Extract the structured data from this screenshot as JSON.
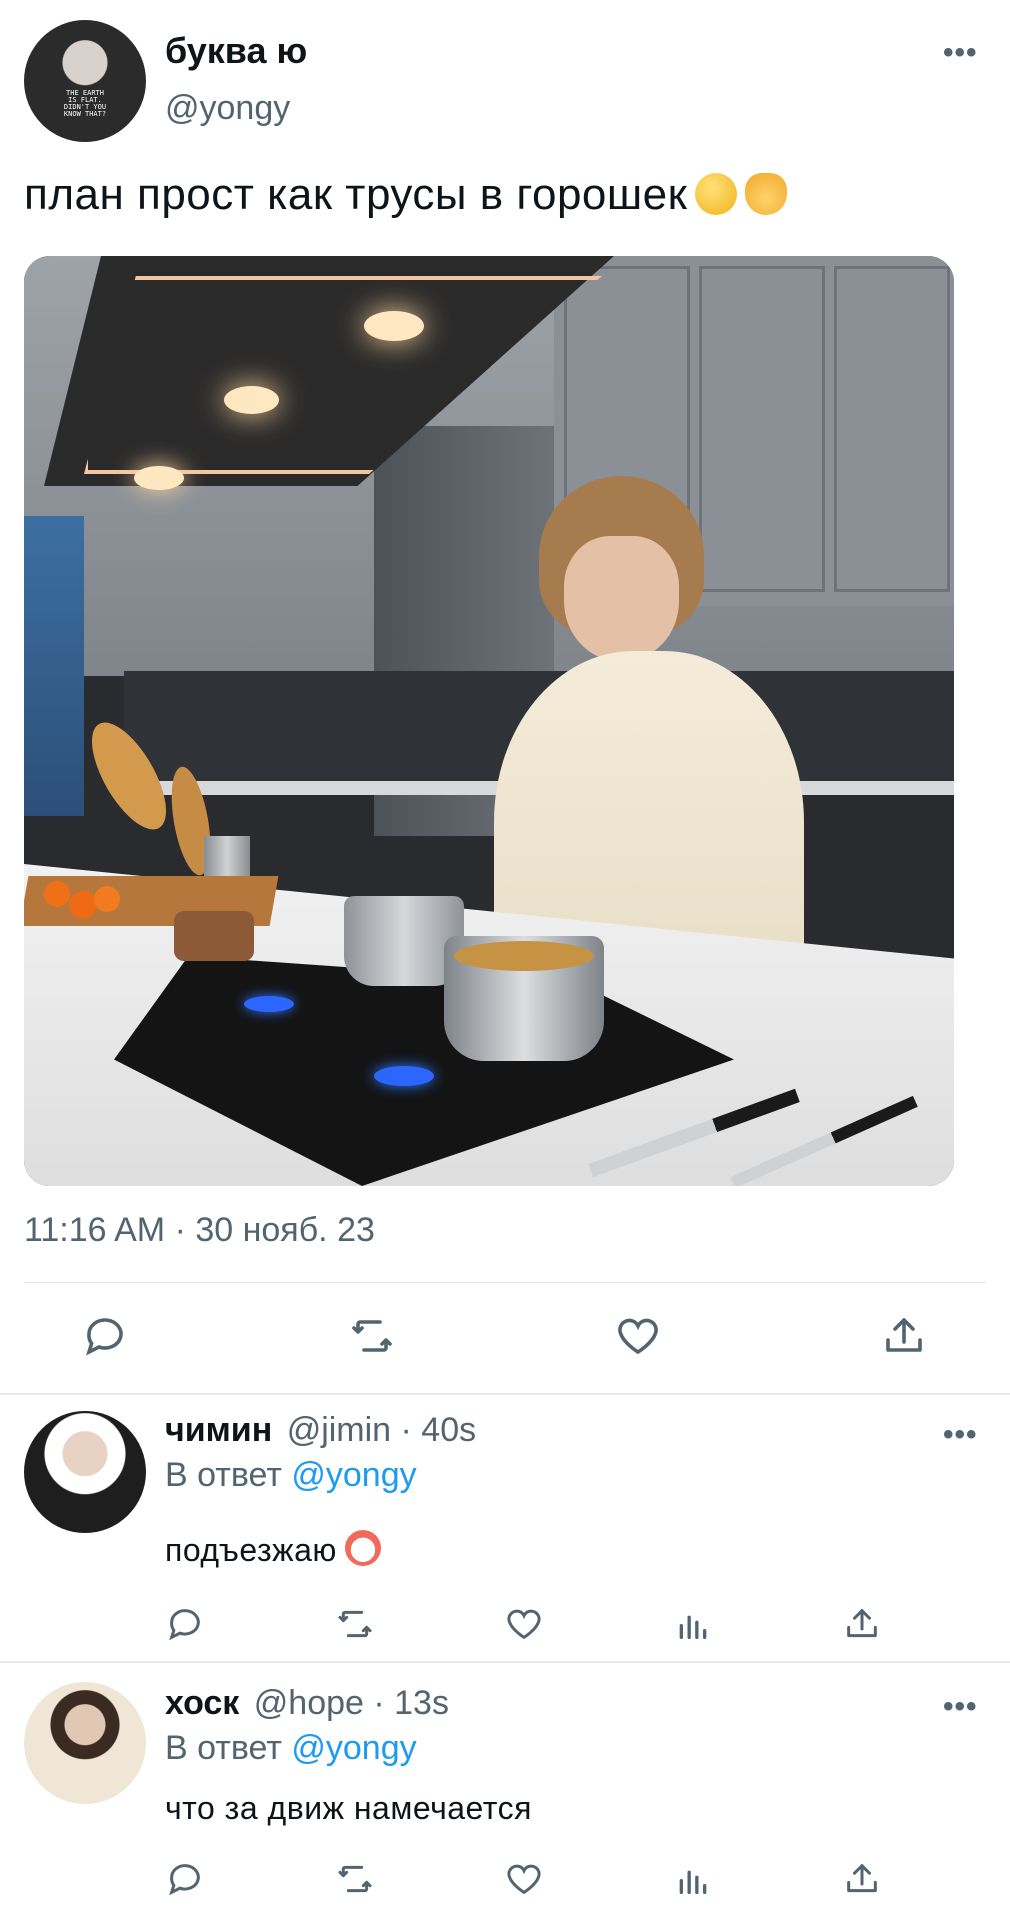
{
  "tweet": {
    "author_name": "буква ю",
    "author_handle": "@yongy",
    "avatar_shirt_text": "THE EARTH IS FLAT. DIDN'T YOU KNOW THAT?",
    "text": "план прост как трусы в горошек",
    "timestamp": "11:16 AM · 30 нояб. 23",
    "more_label": "•••"
  },
  "replies": [
    {
      "name": "чимин",
      "meta": "@jimin · 40s",
      "reply_prefix": "В ответ",
      "reply_mention": "@yongy",
      "text": "подъезжаю"
    },
    {
      "name": "хоск",
      "meta": "@hope · 13s",
      "reply_prefix": "В ответ",
      "reply_mention": "@yongy",
      "text": "что за движ намечается"
    }
  ],
  "icons": {
    "reply": "reply-icon",
    "retweet": "retweet-icon",
    "like": "like-icon",
    "views": "views-icon",
    "share": "share-icon"
  },
  "colors": {
    "text": "#0f1419",
    "secondary": "#536471",
    "link": "#1d9bf0",
    "divider": "#e1e6ea"
  }
}
